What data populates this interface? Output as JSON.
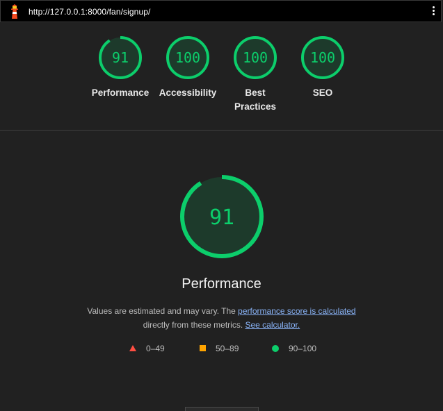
{
  "topbar": {
    "url": "http://127.0.0.1:8000/fan/signup/",
    "logo_icon": "lighthouse-icon",
    "menu_icon": "kebab-menu-icon"
  },
  "summary": {
    "gauges": [
      {
        "label": "Performance",
        "score": "91",
        "fraction": 0.91
      },
      {
        "label": "Accessibility",
        "score": "100",
        "fraction": 1.0
      },
      {
        "label": "Best Practices",
        "score": "100",
        "fraction": 1.0
      },
      {
        "label": "SEO",
        "score": "100",
        "fraction": 1.0
      }
    ]
  },
  "main": {
    "score": "91",
    "fraction": 0.91,
    "title": "Performance",
    "desc_text_1": "Values are estimated and may vary. The ",
    "desc_link_1": "performance score is calculated",
    "desc_text_2": "directly from these metrics. ",
    "desc_link_2": "See calculator.",
    "legend": [
      {
        "range": "0–49",
        "shape": "triangle",
        "color": "#ff4e42"
      },
      {
        "range": "50–89",
        "shape": "square",
        "color": "#ffa400"
      },
      {
        "range": "90–100",
        "shape": "circle",
        "color": "#0cce6b"
      }
    ]
  },
  "colors": {
    "pass": "#0cce6b",
    "average": "#ffa400",
    "fail": "#ff4e42",
    "link": "#8ab4f8",
    "background": "#212121"
  }
}
